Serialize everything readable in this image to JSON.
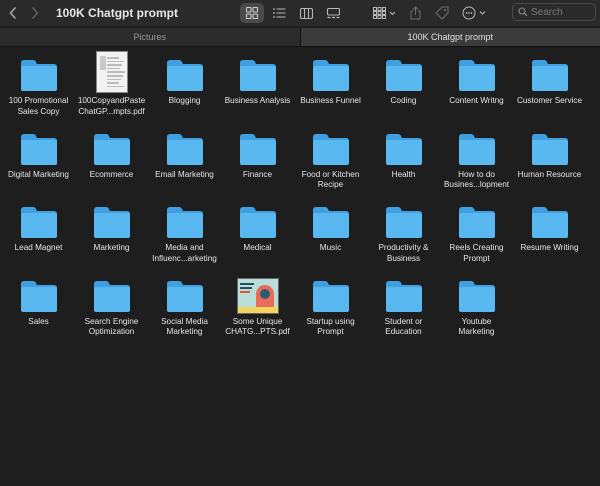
{
  "window": {
    "title": "100K Chatgpt prompt"
  },
  "search": {
    "placeholder": "Search"
  },
  "tabs": [
    {
      "label": "Pictures",
      "active": false
    },
    {
      "label": "100K Chatgpt prompt",
      "active": true
    }
  ],
  "items": [
    {
      "type": "folder",
      "label": "100 Promotional\nSales Copy"
    },
    {
      "type": "pdf-doc",
      "label": "100CopyandPaste\nChatGP...mpts.pdf"
    },
    {
      "type": "folder",
      "label": "Blogging"
    },
    {
      "type": "folder",
      "label": "Business Analysis"
    },
    {
      "type": "folder",
      "label": "Business Funnel"
    },
    {
      "type": "folder",
      "label": "Coding"
    },
    {
      "type": "folder",
      "label": "Content Writng"
    },
    {
      "type": "folder",
      "label": "Customer Service"
    },
    {
      "type": "folder",
      "label": "Digital Marketing"
    },
    {
      "type": "folder",
      "label": "Ecommerce"
    },
    {
      "type": "folder",
      "label": "Email Marketing"
    },
    {
      "type": "folder",
      "label": "Finance"
    },
    {
      "type": "folder",
      "label": "Food or Kitchen\nRecipe"
    },
    {
      "type": "folder",
      "label": "Health"
    },
    {
      "type": "folder",
      "label": "How to do\nBusines...lopment"
    },
    {
      "type": "folder",
      "label": "Human Resource"
    },
    {
      "type": "folder",
      "label": "Lead Magnet"
    },
    {
      "type": "folder",
      "label": "Marketing"
    },
    {
      "type": "folder",
      "label": "Media and\nInfluenc...arketing"
    },
    {
      "type": "folder",
      "label": "Medical"
    },
    {
      "type": "folder",
      "label": "Music"
    },
    {
      "type": "folder",
      "label": "Productivity &\nBusiness"
    },
    {
      "type": "folder",
      "label": "Reels Creating\nPrompt"
    },
    {
      "type": "folder",
      "label": "Resume Writing"
    },
    {
      "type": "folder",
      "label": "Sales"
    },
    {
      "type": "folder",
      "label": "Search Engine\nOptimization"
    },
    {
      "type": "folder",
      "label": "Social Media\nMarketing"
    },
    {
      "type": "pdf-image",
      "label": "Some Unique\nCHATG...PTS.pdf"
    },
    {
      "type": "folder",
      "label": "Startup using\nPrompt"
    },
    {
      "type": "folder",
      "label": "Student or\nEducation"
    },
    {
      "type": "folder",
      "label": "Youtube\nMarketing"
    }
  ],
  "colors": {
    "folder_body": "#5ab8f0",
    "folder_tab": "#3f9fe0",
    "background": "#1e1e1e"
  },
  "toolbar_icons": [
    "back-icon",
    "forward-icon",
    "grid-view-icon",
    "list-view-icon",
    "column-view-icon",
    "gallery-view-icon",
    "group-icon",
    "share-icon",
    "tag-icon",
    "more-actions-icon",
    "search-icon"
  ]
}
